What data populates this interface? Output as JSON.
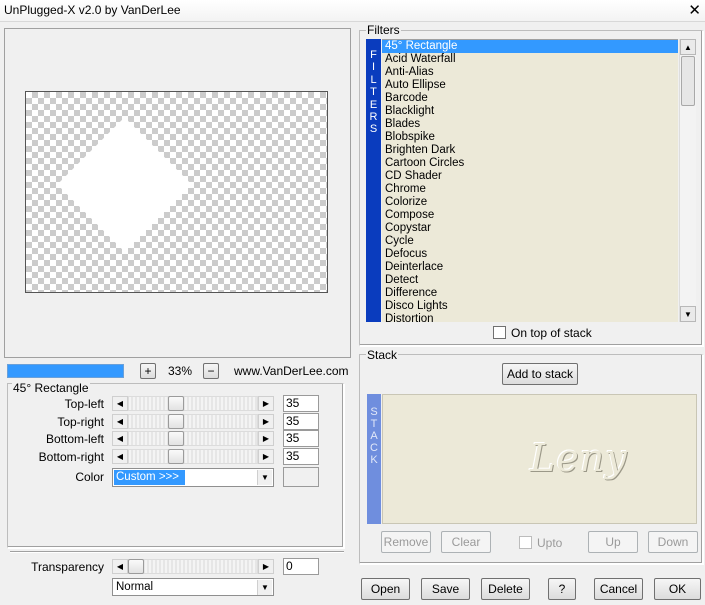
{
  "window": {
    "title": "UnPlugged-X v2.0 by VanDerLee",
    "close_glyph": "✕"
  },
  "filters": {
    "group_label": "Filters",
    "strip_text": "FILTERS",
    "items": [
      "45° Rectangle",
      "Acid Waterfall",
      "Anti-Alias",
      "Auto Ellipse",
      "Barcode",
      "Blacklight",
      "Blades",
      "Blobspike",
      "Brighten Dark",
      "Cartoon Circles",
      "CD Shader",
      "Chrome",
      "Colorize",
      "Compose",
      "Copystar",
      "Cycle",
      "Defocus",
      "Deinterlace",
      "Detect",
      "Difference",
      "Disco Lights",
      "Distortion"
    ],
    "selected_index": 0,
    "on_top_label": "On top of stack",
    "on_top_checked": false
  },
  "preview": {
    "zoom": "33%",
    "zoom_in": "+",
    "zoom_out": "−",
    "website": "www.VanDerLee.com",
    "progress": 1.0
  },
  "stack": {
    "group_label": "Stack",
    "strip_text": "STACK",
    "add_label": "Add to stack",
    "remove_label": "Remove",
    "clear_label": "Clear",
    "upto_label": "Upto",
    "up_label": "Up",
    "down_label": "Down",
    "watermark": "Leny"
  },
  "params": {
    "group_label": "45° Rectangle",
    "sliders": [
      {
        "label": "Top-left",
        "value": "35"
      },
      {
        "label": "Top-right",
        "value": "35"
      },
      {
        "label": "Bottom-left",
        "value": "35"
      },
      {
        "label": "Bottom-right",
        "value": "35"
      }
    ],
    "color_label": "Color",
    "color_value": "Custom >>>",
    "transparency_label": "Transparency",
    "transparency_value": "0",
    "blend_mode": "Normal"
  },
  "buttons": {
    "open": "Open",
    "save": "Save",
    "delete": "Delete",
    "help": "?",
    "cancel": "Cancel",
    "ok": "OK"
  },
  "colors": {
    "selection": "#3399ff",
    "filters_strip": "#0a3cbe",
    "stack_strip": "#6f8ede",
    "list_bg": "#ece9d8"
  }
}
